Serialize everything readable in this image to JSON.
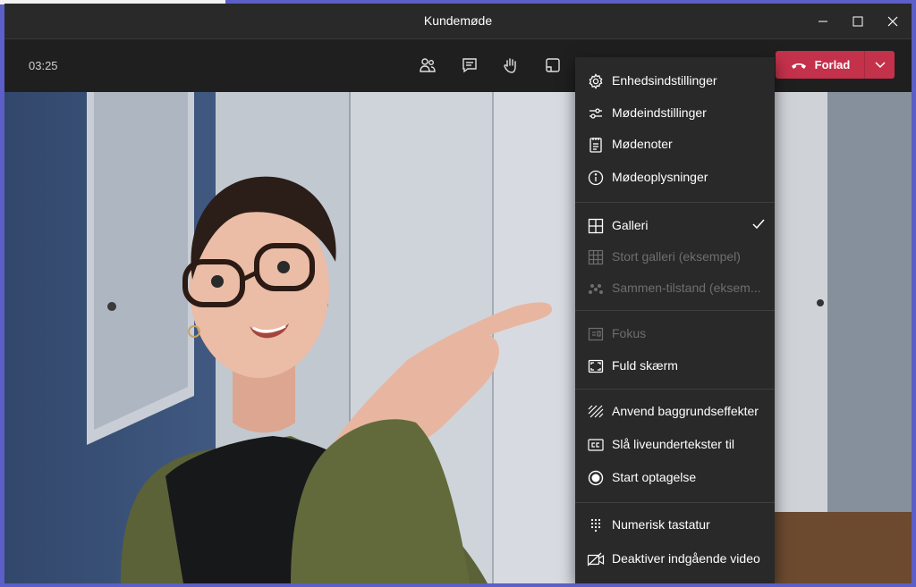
{
  "window": {
    "title": "Kundemøde"
  },
  "toolbar": {
    "timer": "03:25"
  },
  "leave": {
    "label": "Forlad"
  },
  "colors": {
    "accent": "#c4314b",
    "menu_bg": "#292929",
    "toolbar_bg": "#1f1f1f",
    "disabled_text": "#6e6e6e"
  },
  "menu": {
    "items": [
      {
        "label": "Enhedsindstillinger",
        "icon": "gear-icon",
        "enabled": true
      },
      {
        "label": "Mødeindstillinger",
        "icon": "sliders-icon",
        "enabled": true
      },
      {
        "label": "Mødenoter",
        "icon": "notes-icon",
        "enabled": true
      },
      {
        "label": "Mødeoplysninger",
        "icon": "info-icon",
        "enabled": true
      },
      {
        "label": "Galleri",
        "icon": "grid-icon",
        "enabled": true,
        "checked": true
      },
      {
        "label": "Stort galleri (eksempel)",
        "icon": "large-grid-icon",
        "enabled": false
      },
      {
        "label": "Sammen-tilstand (eksem...",
        "icon": "together-mode-icon",
        "enabled": false
      },
      {
        "label": "Fokus",
        "icon": "focus-icon",
        "enabled": false
      },
      {
        "label": "Fuld skærm",
        "icon": "fullscreen-icon",
        "enabled": true
      },
      {
        "label": "Anvend baggrundseffekter",
        "icon": "background-effects-icon",
        "enabled": true
      },
      {
        "label": "Slå liveundertekster til",
        "icon": "captions-icon",
        "enabled": true
      },
      {
        "label": "Start optagelse",
        "icon": "record-icon",
        "enabled": true
      },
      {
        "label": "Numerisk tastatur",
        "icon": "dialpad-icon",
        "enabled": true
      },
      {
        "label": "Deaktiver indgående video",
        "icon": "video-off-icon",
        "enabled": true
      }
    ]
  }
}
